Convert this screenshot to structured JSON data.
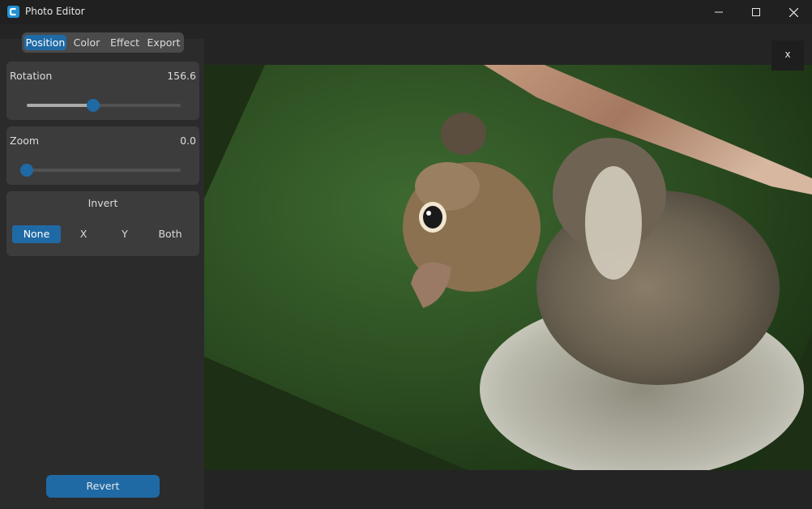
{
  "window": {
    "title": "Photo Editor",
    "controls": [
      "minimize",
      "maximize",
      "close"
    ]
  },
  "tabs": [
    {
      "label": "Position",
      "active": true
    },
    {
      "label": "Color",
      "active": false
    },
    {
      "label": "Effect",
      "active": false
    },
    {
      "label": "Export",
      "active": false
    }
  ],
  "rotation": {
    "label": "Rotation",
    "value": "156.6",
    "slider_fraction": 0.43
  },
  "zoom": {
    "label": "Zoom",
    "value": "0.0",
    "slider_fraction": 0.0
  },
  "invert": {
    "label": "Invert",
    "options": [
      {
        "label": "None",
        "active": true
      },
      {
        "label": "X",
        "active": false
      },
      {
        "label": "Y",
        "active": false
      },
      {
        "label": "Both",
        "active": false
      }
    ]
  },
  "revert_label": "Revert",
  "close_label": "x",
  "colors": {
    "accent": "#1f6aa5",
    "panel": "#3c3c3c",
    "background": "#242424"
  },
  "image": {
    "subject": "squirrel hanging upside down from a branch, rotated"
  }
}
